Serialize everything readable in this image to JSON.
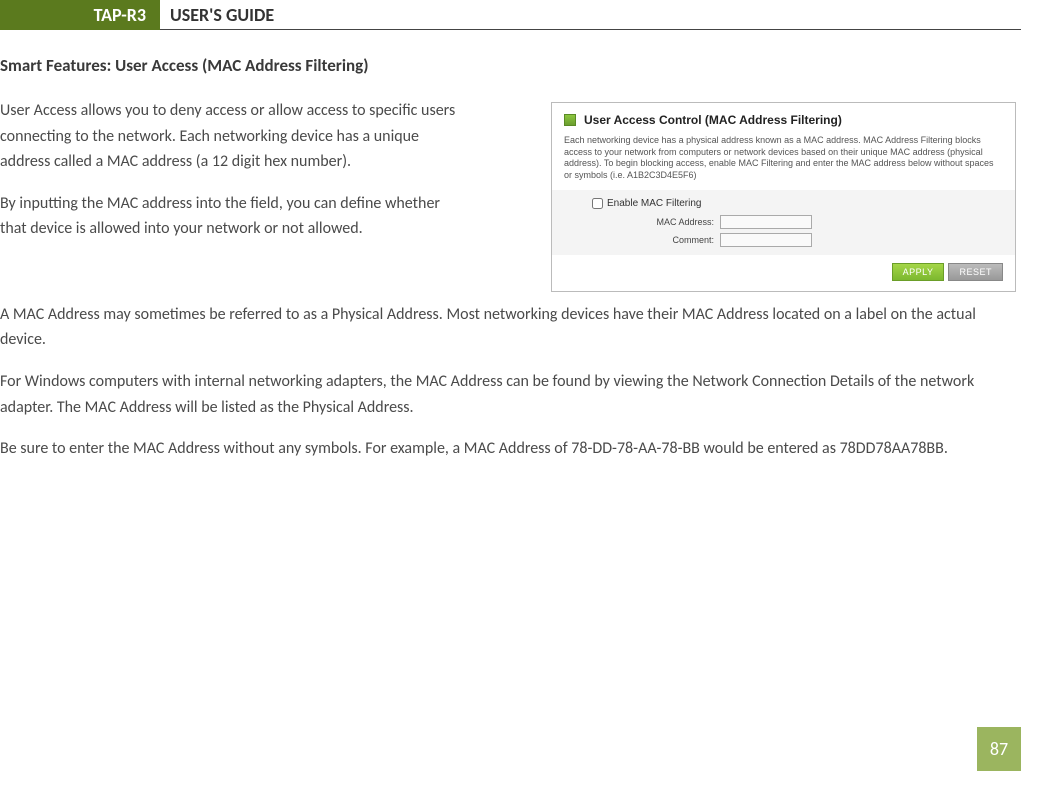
{
  "header": {
    "brand": "TAP-R3",
    "title": "USER'S GUIDE"
  },
  "section_title": "Smart Features: User Access (MAC Address Filtering)",
  "paragraphs": {
    "p1": "User Access allows you to deny access or allow access to specific users connecting to the network.  Each networking device has a unique address called a MAC address (a 12 digit hex number).",
    "p2": "By inputting the MAC address into the field, you can define whether that device is allowed into your network or not allowed.",
    "p3": "A MAC Address may sometimes be referred to as a Physical Address.  Most networking devices have their MAC Address located on a label on the actual device.",
    "p4": "For Windows computers with internal networking adapters, the MAC Address can be found by viewing the Network Connection Details of the network adapter.  The MAC Address will be listed as the Physical Address.",
    "p5": "Be sure to enter the MAC Address without any symbols.  For example, a MAC Address of 78-DD-78-AA-78-BB would be entered as 78DD78AA78BB."
  },
  "panel": {
    "title": "User Access Control (MAC Address Filtering)",
    "description": "Each networking device has a physical address known as a MAC address. MAC Address Filtering blocks access to your network from computers or network devices based on their unique MAC address (physical address). To begin blocking access, enable MAC Filtering and enter the MAC address below without spaces or symbols (i.e. A1B2C3D4E5F6)",
    "enable_label": "Enable MAC Filtering",
    "fields": {
      "mac_label": "MAC Address:",
      "mac_value": "",
      "comment_label": "Comment:",
      "comment_value": ""
    },
    "buttons": {
      "apply": "APPLY",
      "reset": "RESET"
    }
  },
  "page_number": "87"
}
